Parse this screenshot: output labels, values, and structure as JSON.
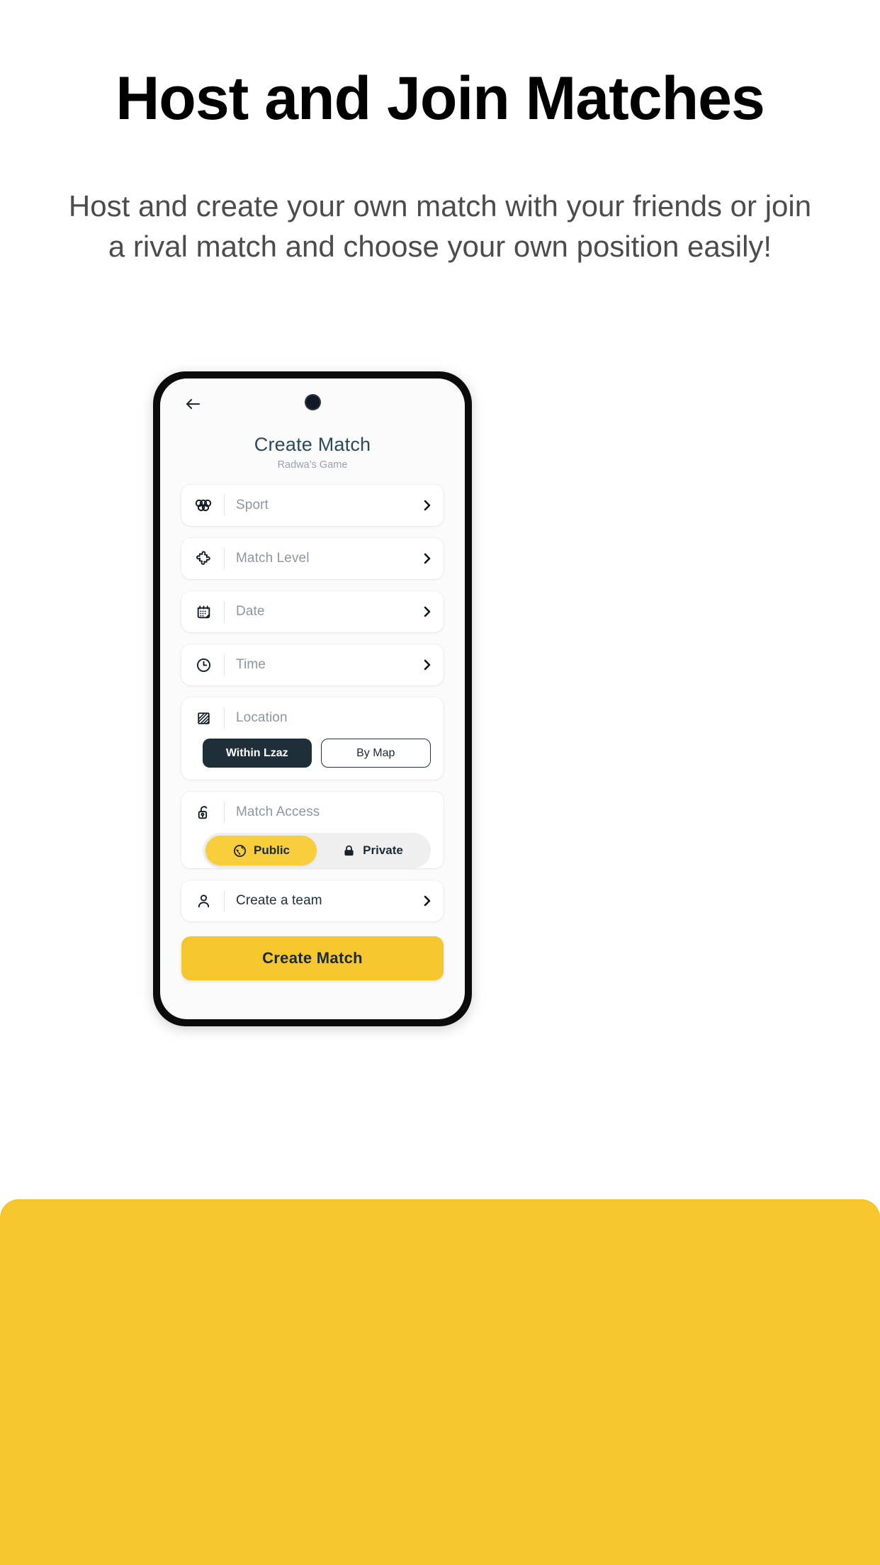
{
  "page": {
    "headline": "Host and Join Matches",
    "subheadline": "Host and create your own match with your friends or join a rival match and choose your own position easily!",
    "background_color": "#FFFFFF",
    "accent_color": "#F5C62E"
  },
  "phone": {
    "frame_color": "#0B0B0B",
    "screen_bg": "#FBFBFB",
    "header": {
      "back_icon": "arrow-left-icon",
      "camera": "front-camera-dot",
      "title": "Create Match",
      "subtitle": "Radwa’s Game"
    },
    "rows": [
      {
        "icon": "olympic-rings-icon",
        "label": "Sport",
        "chevron": "chevron-right-icon",
        "label_tone": "placeholder"
      },
      {
        "icon": "puzzle-piece-icon",
        "label": "Match Level",
        "chevron": "chevron-right-icon",
        "label_tone": "placeholder"
      },
      {
        "icon": "calendar-icon",
        "label": "Date",
        "chevron": "chevron-right-icon",
        "label_tone": "placeholder"
      },
      {
        "icon": "clock-icon",
        "label": "Time",
        "chevron": "chevron-right-icon",
        "label_tone": "placeholder"
      }
    ],
    "location": {
      "icon": "pitch-field-icon",
      "label": "Location",
      "options": [
        {
          "label": "Within Lzaz",
          "selected": true
        },
        {
          "label": "By Map",
          "selected": false
        }
      ]
    },
    "access": {
      "icon": "unlock-icon",
      "label": "Match Access",
      "options": [
        {
          "label": "Public",
          "icon": "globe-icon",
          "selected": true
        },
        {
          "label": "Private",
          "icon": "lock-icon",
          "selected": false
        }
      ]
    },
    "team_row": {
      "icon": "person-icon",
      "label": "Create a team",
      "chevron": "chevron-right-icon"
    },
    "cta": {
      "label": "Create Match",
      "color": "#F5C62E"
    }
  }
}
